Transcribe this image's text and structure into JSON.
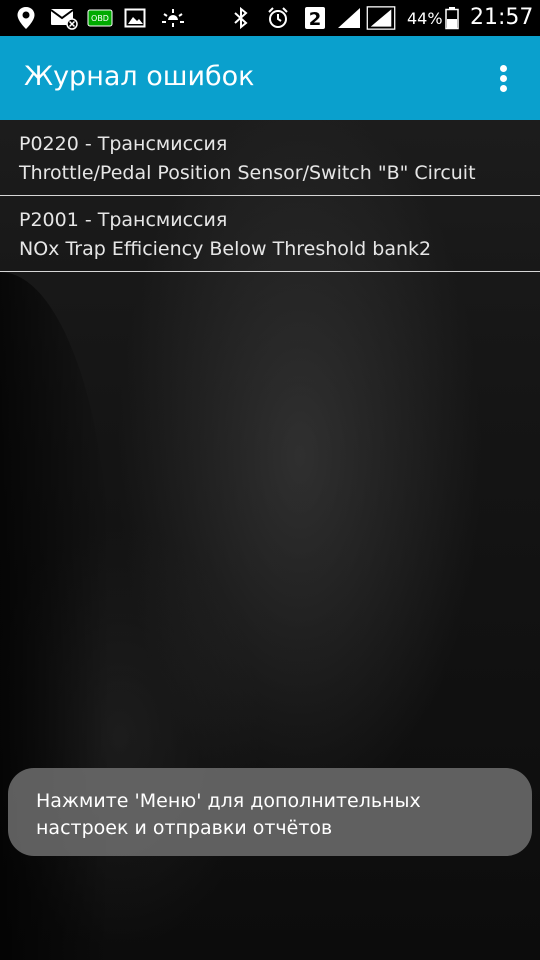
{
  "status_bar": {
    "icons_left": [
      "location-icon",
      "email-notification-icon",
      "obd-icon",
      "image-icon",
      "brightness-icon"
    ],
    "icons_right": [
      "bluetooth-icon",
      "alarm-icon",
      "sim-2-icon",
      "signal-icon",
      "signal-icon-2"
    ],
    "sim_label": "2",
    "obd_label": "OBD",
    "battery_percent": "44%",
    "time": "21:57"
  },
  "app_bar": {
    "title": "Журнал ошибок",
    "background_color": "#0aa0cd",
    "overflow_icon": "more-vert-icon"
  },
  "errors": [
    {
      "code_line": "P0220 - Трансмиссия",
      "description": "Throttle/Pedal Position Sensor/Switch \"B\" Circuit"
    },
    {
      "code_line": "P2001 - Трансмиссия",
      "description": "NOx Trap Efficiency Below Threshold bank2"
    }
  ],
  "toast": {
    "line1": "Нажмите 'Меню' для дополнительных",
    "line2": "настроек и отправки отчётов"
  }
}
